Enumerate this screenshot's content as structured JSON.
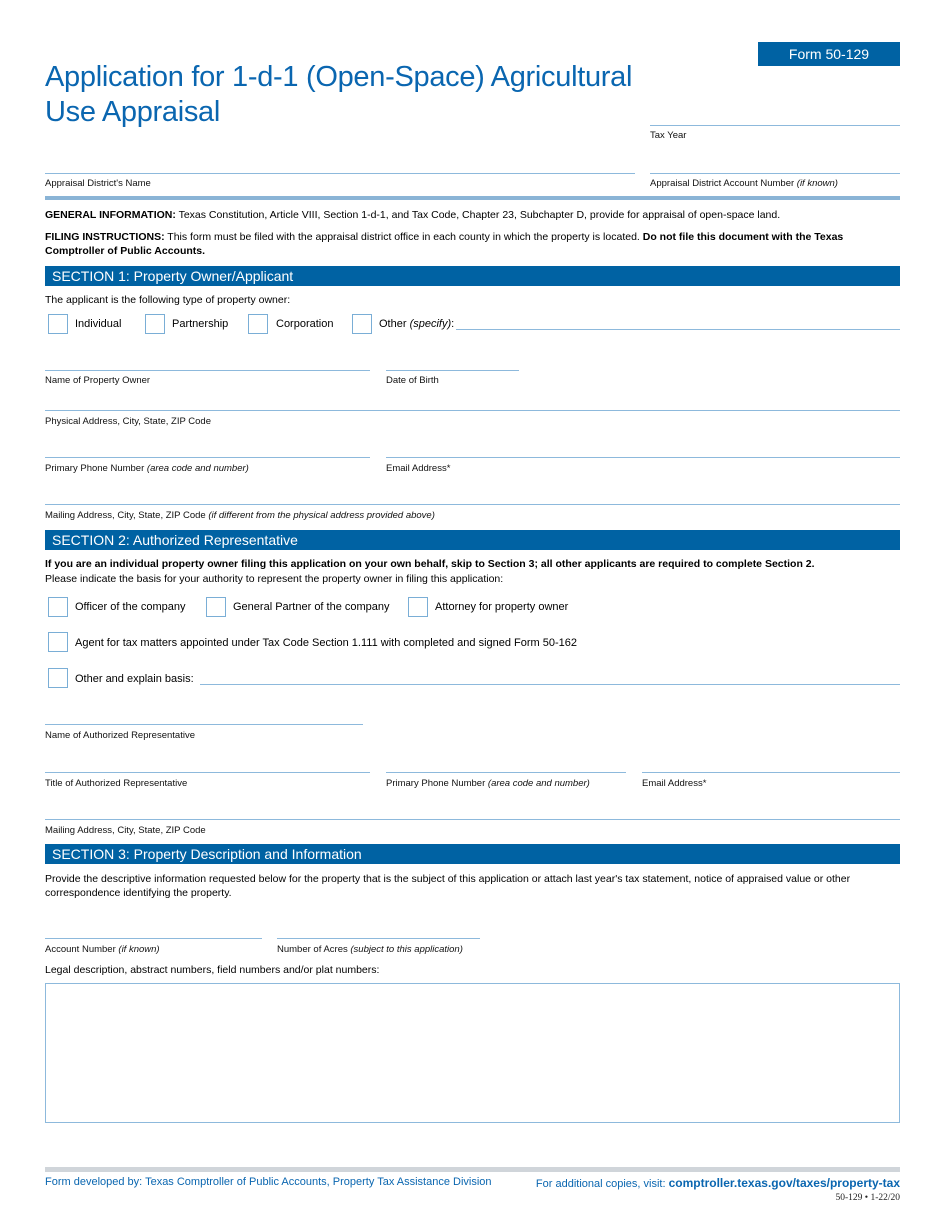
{
  "header": {
    "form_number": "Form 50-129",
    "title": "Application for 1-d-1 (Open-Space) Agricultural Use Appraisal",
    "tax_year_label": "Tax Year",
    "district_name_label": "Appraisal District's Name",
    "district_account_label": "Appraisal District Account Number",
    "district_account_note": "(if known)"
  },
  "general_info": {
    "heading": "GENERAL INFORMATION:",
    "text": " Texas Constitution, Article VIII, Section 1-d-1, and Tax Code, Chapter 23, Subchapter D, provide for appraisal of open-space land."
  },
  "filing_instructions": {
    "heading": "FILING INSTRUCTIONS:",
    "text": " This form must be filed with the appraisal district office in each county in which the property is located. ",
    "bold_text": "Do not file this document with the Texas Comptroller of Public Accounts."
  },
  "section1": {
    "title": "SECTION 1: Property Owner/Applicant",
    "intro": "The applicant is the following type of property owner:",
    "owner_types": [
      "Individual",
      "Partnership",
      "Corporation"
    ],
    "other_label": "Other ",
    "other_note": "(specify)",
    "other_colon": ":",
    "fields": {
      "owner_name": "Name of Property Owner",
      "dob": "Date of Birth",
      "physical_address": "Physical Address, City, State, ZIP Code",
      "phone": "Primary Phone Number ",
      "phone_note": "(area code and number)",
      "email": "Email Address*",
      "mailing_address": "Mailing Address, City, State, ZIP Code ",
      "mailing_note": "(if different from the physical address provided above)"
    }
  },
  "section2": {
    "title": "SECTION 2: Authorized Representative",
    "bold_intro": "If you are an individual property owner filing this application on your own behalf, skip to Section 3; all other applicants are required to complete Section 2.",
    "intro": "Please indicate the basis for your authority to represent the property owner in filing this application:",
    "options": [
      "Officer of the company",
      "General Partner of the company",
      "Attorney for property owner"
    ],
    "agent_option": "Agent for tax matters appointed under Tax Code Section 1.111 with completed and signed Form 50-162",
    "other_option": "Other and explain basis:",
    "fields": {
      "rep_name": "Name of Authorized Representative",
      "rep_title": "Title of Authorized Representative",
      "phone": "Primary Phone Number ",
      "phone_note": "(area code and number)",
      "email": "Email Address*",
      "mailing_address": "Mailing Address, City, State, ZIP Code"
    }
  },
  "section3": {
    "title": "SECTION 3: Property Description and Information",
    "intro": "Provide the descriptive information requested below for the property that is the subject of this application or attach last year's tax statement, notice of appraised value or other correspondence identifying the property.",
    "account_label": "Account Number ",
    "account_note": "(if known)",
    "acres_label": "Number of Acres ",
    "acres_note": "(subject to this application)",
    "legal_label": "Legal description, abstract numbers, field numbers and/or plat numbers:"
  },
  "footer": {
    "developed_by": "Form developed by: Texas Comptroller of Public Accounts, Property Tax Assistance Division",
    "copies_prefix": "For additional copies, visit: ",
    "copies_url": "comptroller.texas.gov/taxes/property-tax",
    "code": "50-129 • 1-22/20"
  },
  "colors": {
    "brand_blue": "#0062a3",
    "title_blue": "#0a66b0",
    "line_blue": "#8db9dc"
  }
}
